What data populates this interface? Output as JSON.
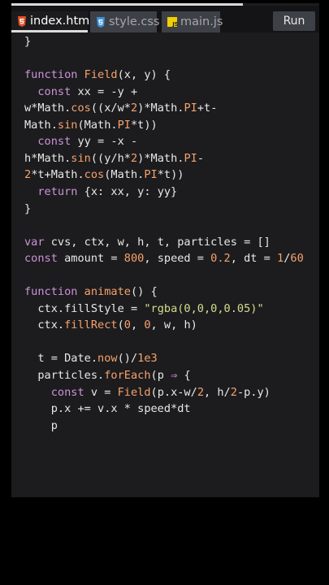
{
  "tabs": [
    {
      "label": "index.html",
      "icon": "html5-icon",
      "color": "#e44d26",
      "active": true
    },
    {
      "label": "style.css",
      "icon": "css3-icon",
      "color": "#3d8fd6",
      "active": false
    },
    {
      "label": "main.js",
      "icon": "js-icon",
      "color": "#f0d000",
      "active": false
    }
  ],
  "run_label": "Run",
  "colors": {
    "keyword": "#ce93d8",
    "function": "#f7a26c",
    "number": "#f7a26c",
    "string": "#d6dc8e",
    "text": "#e8e8e8",
    "editor_bg": "#1c1c1e"
  },
  "code_lines": [
    [
      [
        "}",
        "op"
      ]
    ],
    [],
    [
      [
        "function",
        "kw"
      ],
      [
        " ",
        "op"
      ],
      [
        "Field",
        "fn"
      ],
      [
        "(x, y) {",
        "op"
      ]
    ],
    [
      [
        "  ",
        "op"
      ],
      [
        "const",
        "kw"
      ],
      [
        " xx = -y +",
        "op"
      ]
    ],
    [
      [
        "w*Math.",
        "op"
      ],
      [
        "cos",
        "fn"
      ],
      [
        "((x/w*",
        "op"
      ],
      [
        "2",
        "num"
      ],
      [
        ")*Math.",
        "op"
      ],
      [
        "PI",
        "fn"
      ],
      [
        "+t-",
        "op"
      ]
    ],
    [
      [
        "Math.",
        "op"
      ],
      [
        "sin",
        "fn"
      ],
      [
        "(Math.",
        "op"
      ],
      [
        "PI",
        "fn"
      ],
      [
        "*t))",
        "op"
      ]
    ],
    [
      [
        "  ",
        "op"
      ],
      [
        "const",
        "kw"
      ],
      [
        " yy = -x -",
        "op"
      ]
    ],
    [
      [
        "h*Math.",
        "op"
      ],
      [
        "sin",
        "fn"
      ],
      [
        "((y/h*",
        "op"
      ],
      [
        "2",
        "num"
      ],
      [
        ")*Math.",
        "op"
      ],
      [
        "PI",
        "fn"
      ],
      [
        "-",
        "op"
      ]
    ],
    [
      [
        "2",
        "num"
      ],
      [
        "*t+Math.",
        "op"
      ],
      [
        "cos",
        "fn"
      ],
      [
        "(Math.",
        "op"
      ],
      [
        "PI",
        "fn"
      ],
      [
        "*t))",
        "op"
      ]
    ],
    [
      [
        "  ",
        "op"
      ],
      [
        "return",
        "kw"
      ],
      [
        " {x: xx, y: yy}",
        "op"
      ]
    ],
    [
      [
        "}",
        "op"
      ]
    ],
    [],
    [
      [
        "var",
        "kw"
      ],
      [
        " cvs, ctx, w, h, t, particles = []",
        "op"
      ]
    ],
    [
      [
        "const",
        "kw"
      ],
      [
        " amount = ",
        "op"
      ],
      [
        "800",
        "num"
      ],
      [
        ", speed = ",
        "op"
      ],
      [
        "0.2",
        "num"
      ],
      [
        ", dt = ",
        "op"
      ],
      [
        "1",
        "num"
      ],
      [
        "/",
        "op"
      ],
      [
        "60",
        "num"
      ]
    ],
    [],
    [
      [
        "function",
        "kw"
      ],
      [
        " ",
        "op"
      ],
      [
        "animate",
        "fn"
      ],
      [
        "() {",
        "op"
      ]
    ],
    [
      [
        "  ctx.fillStyle = ",
        "op"
      ],
      [
        "\"rgba(0,0,0,0.05)\"",
        "str"
      ]
    ],
    [
      [
        "  ctx.",
        "op"
      ],
      [
        "fillRect",
        "fn"
      ],
      [
        "(",
        "op"
      ],
      [
        "0",
        "num"
      ],
      [
        ", ",
        "op"
      ],
      [
        "0",
        "num"
      ],
      [
        ", w, h)",
        "op"
      ]
    ],
    [],
    [
      [
        "  t = Date.",
        "op"
      ],
      [
        "now",
        "fn"
      ],
      [
        "()/",
        "op"
      ],
      [
        "1e3",
        "num"
      ]
    ],
    [
      [
        "  particles.",
        "op"
      ],
      [
        "forEach",
        "fn"
      ],
      [
        "(p ",
        "op"
      ],
      [
        "⇒",
        "kw"
      ],
      [
        " {",
        "op"
      ]
    ],
    [
      [
        "    ",
        "op"
      ],
      [
        "const",
        "kw"
      ],
      [
        " v = ",
        "op"
      ],
      [
        "Field",
        "fn"
      ],
      [
        "(p.x-w/",
        "op"
      ],
      [
        "2",
        "num"
      ],
      [
        ", h/",
        "op"
      ],
      [
        "2",
        "num"
      ],
      [
        "-p.y)",
        "op"
      ]
    ],
    [
      [
        "    p.x += v.x * speed*dt",
        "op"
      ]
    ],
    [
      [
        "    p",
        "op"
      ]
    ]
  ]
}
